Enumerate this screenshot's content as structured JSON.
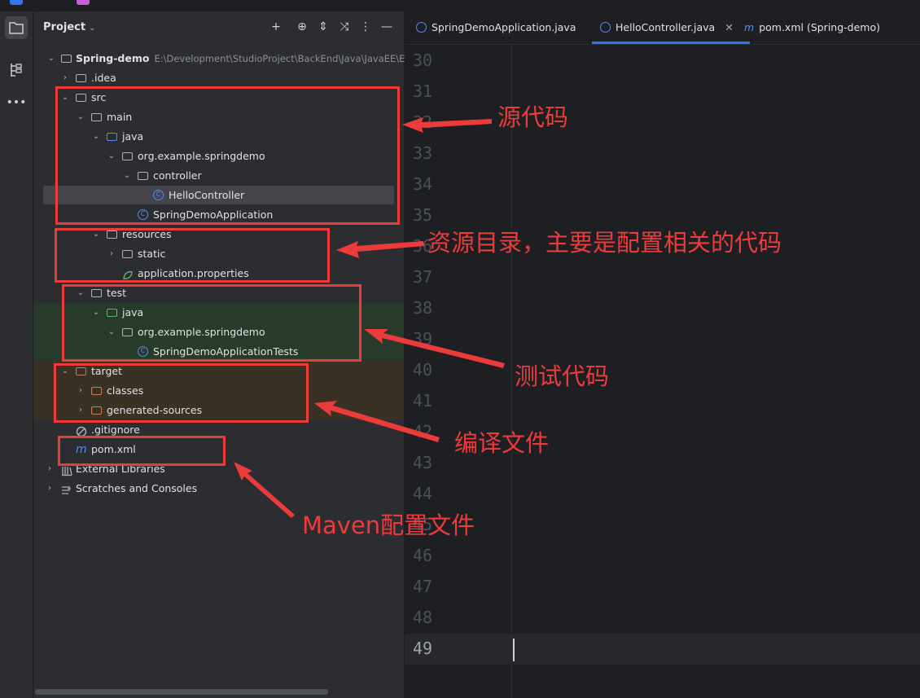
{
  "colors": {
    "accent": "#3574f0",
    "annotation_red": "#ec3b3b",
    "test_band": "#283a2a",
    "target_band": "#3a3125"
  },
  "project_panel": {
    "title": "Project",
    "toolbar_icons": [
      "add-icon",
      "target-icon",
      "expand-icon",
      "collapse-icon",
      "more-icon",
      "minimize-icon"
    ]
  },
  "tree": {
    "root_name": "Spring-demo",
    "root_path": "E:\\Development\\StudioProject\\BackEnd\\Java\\JavaEE\\El",
    "idea": ".idea",
    "src": "src",
    "main": "main",
    "java_main": "java",
    "package_main": "org.example.springdemo",
    "controller": "controller",
    "hello_controller": "HelloController",
    "app_class": "SpringDemoApplication",
    "resources": "resources",
    "static": "static",
    "app_properties": "application.properties",
    "test": "test",
    "java_test": "java",
    "package_test": "org.example.springdemo",
    "app_tests": "SpringDemoApplicationTests",
    "target": "target",
    "classes": "classes",
    "generated_sources": "generated-sources",
    "gitignore": ".gitignore",
    "pom": "pom.xml",
    "external_libraries": "External Libraries",
    "scratches": "Scratches and Consoles"
  },
  "editor": {
    "tabs": [
      {
        "label": "SpringDemoApplication.java"
      },
      {
        "label": "HelloController.java"
      },
      {
        "label": "pom.xml (Spring-demo)"
      }
    ],
    "line_numbers": [
      "30",
      "31",
      "32",
      "33",
      "34",
      "35",
      "36",
      "37",
      "38",
      "39",
      "40",
      "41",
      "42",
      "43",
      "44",
      "45",
      "46",
      "47",
      "48",
      "49"
    ]
  },
  "annotations": {
    "source": "源代码",
    "resources": "资源目录，主要是配置相关的代码",
    "test": "测试代码",
    "compiled": "编译文件",
    "maven": "Maven配置文件"
  }
}
